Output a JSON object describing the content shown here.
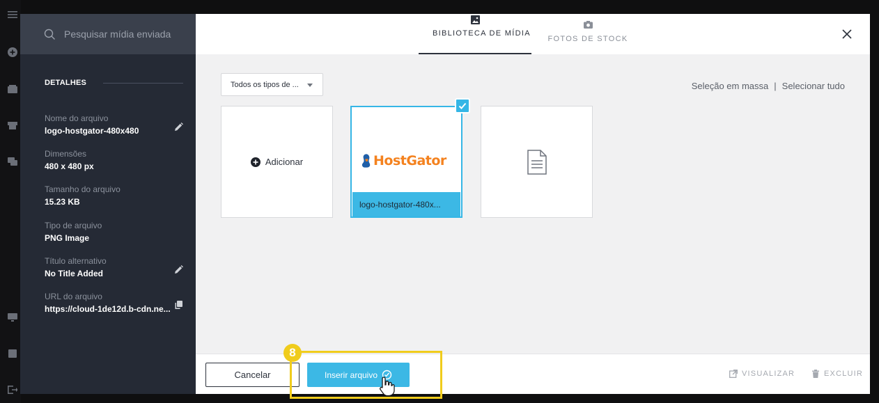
{
  "sidebar": {
    "search_placeholder": "Pesquisar mídia enviada",
    "details_title": "DETALHES",
    "fields": [
      {
        "label": "Nome do arquivo",
        "value": "logo-hostgator-480x480"
      },
      {
        "label": "Dimensões",
        "value": "480 x 480 px"
      },
      {
        "label": "Tamanho do arquivo",
        "value": "15.23 KB"
      },
      {
        "label": "Tipo de arquivo",
        "value": "PNG Image"
      },
      {
        "label": "Título alternativo",
        "value": "No Title Added"
      },
      {
        "label": "URL do arquivo",
        "value": "https://cloud-1de12d.b-cdn.ne..."
      }
    ]
  },
  "header": {
    "tabs": [
      {
        "label": "BIBLIOTECA DE MÍDIA",
        "icon": "image-icon",
        "active": true
      },
      {
        "label": "FOTOS DE STOCK",
        "icon": "camera-icon",
        "active": false
      }
    ]
  },
  "content": {
    "filter_value": "Todos os tipos de ...",
    "bulk_select": "Seleção em massa",
    "bulk_separator": "|",
    "select_all": "Selecionar tudo",
    "add_label": "Adicionar",
    "selected_file": {
      "logo_text": "HostGator",
      "caption": "logo-hostgator-480x..."
    }
  },
  "footer": {
    "cancel_label": "Cancelar",
    "insert_label": "Inserir arquivo",
    "preview_label": "VISUALIZAR",
    "delete_label": "EXCLUIR"
  },
  "annotation": {
    "step_number": "8"
  },
  "colors": {
    "accent": "#3cb8e5",
    "sidebar_bg": "#252a35",
    "highlight": "#f0cc1c",
    "logo_orange": "#f4821f"
  }
}
